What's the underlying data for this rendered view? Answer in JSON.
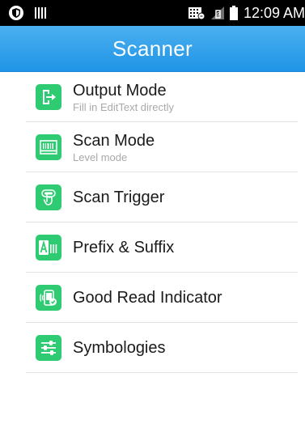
{
  "status_bar": {
    "time": "12:09 AM",
    "left_icons": [
      "shield-icon",
      "barcode-icon"
    ],
    "right_icons": [
      "sim-icon",
      "no-signal-icon",
      "battery-icon"
    ]
  },
  "header": {
    "title": "Scanner"
  },
  "menu": [
    {
      "title": "Output Mode",
      "subtitle": "Fill in EditText directly",
      "icon": "output-mode-icon"
    },
    {
      "title": "Scan Mode",
      "subtitle": "Level mode",
      "icon": "scan-mode-icon"
    },
    {
      "title": "Scan Trigger",
      "subtitle": "",
      "icon": "scan-trigger-icon"
    },
    {
      "title": "Prefix & Suffix",
      "subtitle": "",
      "icon": "prefix-suffix-icon"
    },
    {
      "title": "Good Read Indicator",
      "subtitle": "",
      "icon": "good-read-indicator-icon"
    },
    {
      "title": "Symbologies",
      "subtitle": "",
      "icon": "symbologies-icon"
    }
  ],
  "colors": {
    "header": "#1f94e6",
    "icon_green": "#2ecb72",
    "status_bar": "#000000"
  }
}
